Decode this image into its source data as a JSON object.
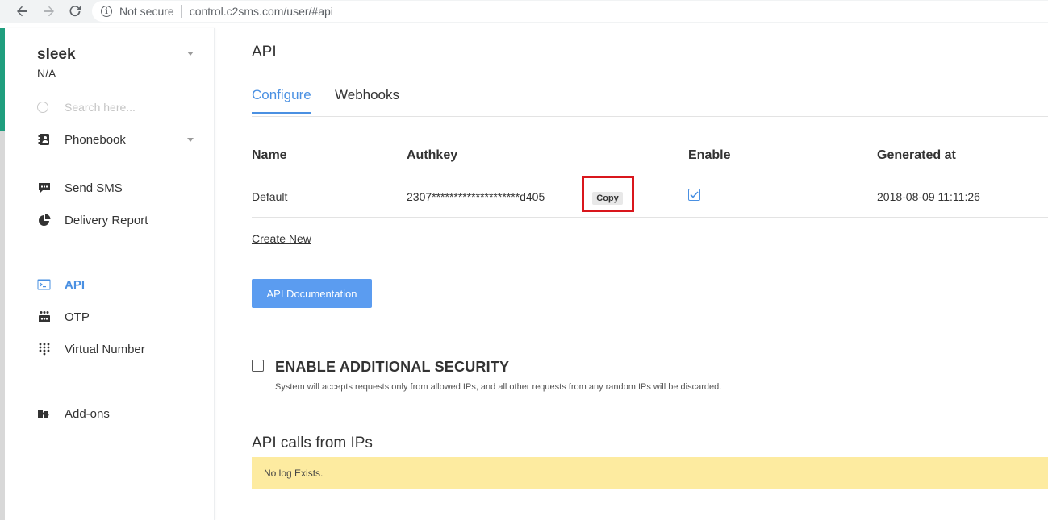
{
  "browser": {
    "security_label": "Not secure",
    "url": "control.c2sms.com/user/#api"
  },
  "sidebar": {
    "account_name": "sleek",
    "account_sub": "N/A",
    "search_placeholder": "Search here...",
    "items": [
      {
        "label": "Phonebook",
        "icon": "phonebook-icon"
      },
      {
        "label": "Send SMS",
        "icon": "message-icon"
      },
      {
        "label": "Delivery Report",
        "icon": "pie-chart-icon"
      },
      {
        "label": "API",
        "icon": "terminal-icon",
        "active": true
      },
      {
        "label": "OTP",
        "icon": "otp-icon"
      },
      {
        "label": "Virtual Number",
        "icon": "dialpad-icon"
      },
      {
        "label": "Add-ons",
        "icon": "addons-icon"
      }
    ]
  },
  "main": {
    "title": "API",
    "tabs": [
      "Configure",
      "Webhooks"
    ],
    "table": {
      "headers": [
        "Name",
        "Authkey",
        "Enable",
        "Generated at"
      ],
      "rows": [
        {
          "name": "Default",
          "authkey": "2307********************d405",
          "copy_label": "Copy",
          "enabled": true,
          "generated_at": "2018-08-09 11:11:26"
        }
      ]
    },
    "create_new_label": "Create New",
    "doc_button_label": "API Documentation",
    "security": {
      "title": "ENABLE ADDITIONAL SECURITY",
      "description": "System will accepts requests only from allowed IPs, and all other requests from any random IPs will be discarded.",
      "checked": false
    },
    "ip_section": {
      "title": "API calls from IPs",
      "empty_message": "No log Exists."
    }
  },
  "colors": {
    "accent": "#4a90e2",
    "sidebar_accent": "#1f9e7e",
    "highlight": "#d9161c",
    "log_bg": "#fdeba0"
  }
}
